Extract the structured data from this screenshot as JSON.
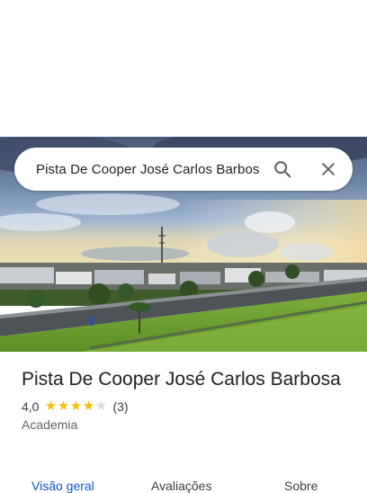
{
  "search": {
    "query": "Pista De Cooper José Carlos Barbos"
  },
  "place": {
    "title": "Pista De Cooper José Carlos Barbosa",
    "rating": "4,0",
    "rating_fraction": 0.8,
    "review_count": "(3)",
    "category": "Academia"
  },
  "tabs": [
    {
      "label": "Visão geral",
      "active": true
    },
    {
      "label": "Avaliações",
      "active": false
    },
    {
      "label": "Sobre",
      "active": false
    }
  ],
  "icons": {
    "search": "search-icon",
    "close": "close-icon",
    "star": "star-icon"
  },
  "colors": {
    "accent": "#0b57d0",
    "star": "#fbbc04",
    "star_empty": "#dadce0"
  }
}
